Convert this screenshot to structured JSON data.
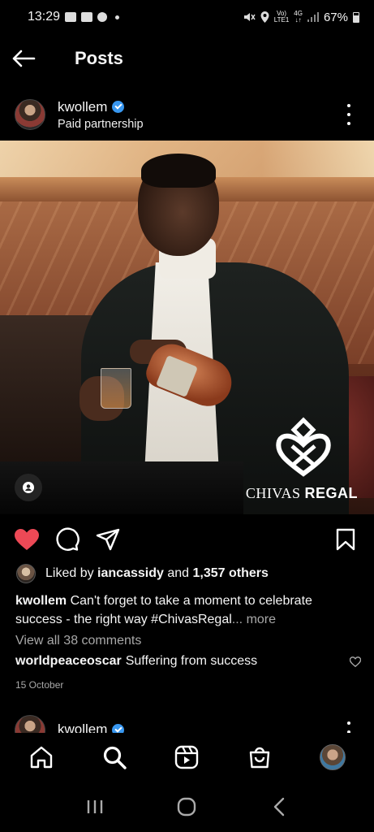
{
  "status_bar": {
    "time": "13:29",
    "network": "Vo) 4G LTE1",
    "battery": "67%"
  },
  "header": {
    "title": "Posts"
  },
  "post": {
    "username": "kwollem",
    "subtitle": "Paid partnership",
    "brand": {
      "name_light": "CHIVAS",
      "name_bold": "REGAL"
    },
    "liked_by_prefix": "Liked by",
    "liked_by_user": "iancassidy",
    "liked_by_and": "and",
    "liked_by_others": "1,357 others",
    "caption_user": "kwollem",
    "caption_text": "Can't forget to take a moment to celebrate success - the right way #ChivasRegal",
    "caption_more": "... more",
    "view_comments": "View all 38 comments",
    "comment_user": "worldpeaceoscar",
    "comment_text": "Suffering from success",
    "date": "15 October",
    "liked": true,
    "accent_like": "#ed4956"
  },
  "next_post": {
    "username": "kwollem"
  },
  "icons": {
    "back": "arrow-left-icon",
    "more": "more-vertical-icon",
    "like": "heart-icon",
    "comment": "comment-icon",
    "share": "send-icon",
    "save": "bookmark-icon",
    "home": "home-icon",
    "search": "search-icon",
    "reels": "reels-icon",
    "shop": "shop-icon"
  }
}
